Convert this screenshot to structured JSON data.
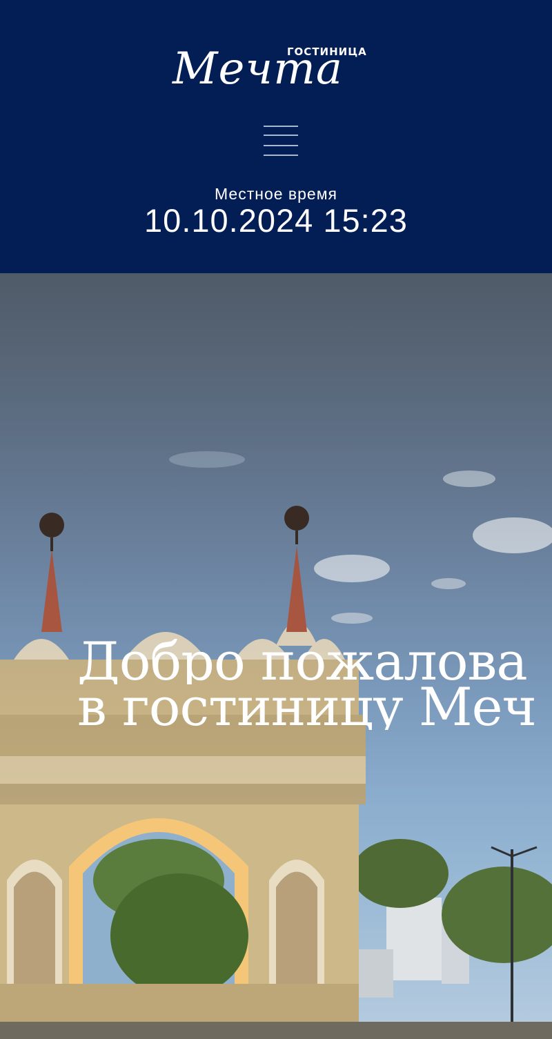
{
  "header": {
    "logo": {
      "small": "ГОСТИНИЦА",
      "script": "Мечта"
    },
    "menu_icon": "hamburger-menu-icon",
    "local_time_label": "Местное время",
    "local_time_value": "10.10.2024 15:23"
  },
  "hero": {
    "image": "triumphal-arch-photo",
    "welcome_line1": "Добро пожалова",
    "welcome_line2": "в гостиницу Меч"
  },
  "colors": {
    "header_bg": "#031e54",
    "text": "#ffffff"
  }
}
